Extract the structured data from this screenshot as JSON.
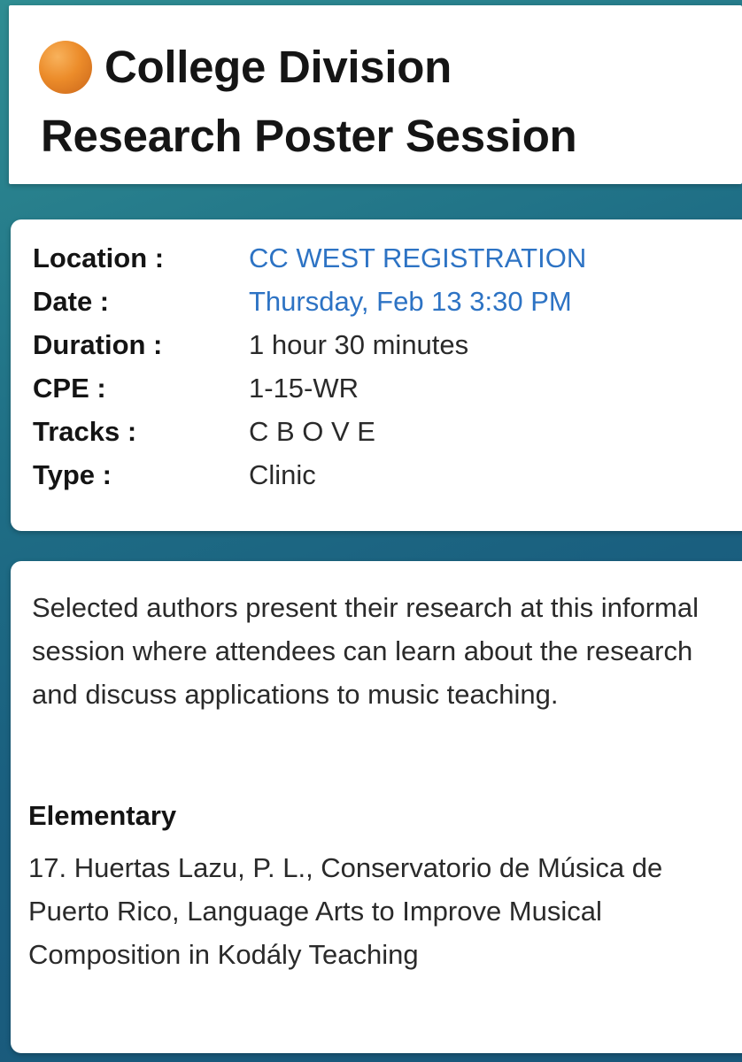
{
  "header": {
    "status_icon": "orange-circle-icon",
    "status_color": "#ec8c2a",
    "title_line1": "College Division",
    "title_line2": "Research Poster Session"
  },
  "details": {
    "location": {
      "label": "Location :",
      "value": "CC WEST REGISTRATION"
    },
    "date": {
      "label": "Date :",
      "value": "Thursday, Feb 13 3:30 PM"
    },
    "duration": {
      "label": "Duration :",
      "value": "1 hour 30 minutes"
    },
    "cpe": {
      "label": "CPE :",
      "value": "1-15-WR"
    },
    "tracks": {
      "label": "Tracks :",
      "value": "C B O V E"
    },
    "type": {
      "label": "Type :",
      "value": "Clinic"
    }
  },
  "description": {
    "text": "Selected authors present their research at this informal session where attendees can learn about the research and discuss applications to music teaching.",
    "section_heading": "Elementary",
    "presentation": "17. Huertas Lazu, P. L., Conservatorio de Música de Puerto Rico, Language Arts to Improve Musical Composition in Kodály Teaching"
  },
  "colors": {
    "link": "#2d73c4",
    "background": "#1f6f86"
  }
}
